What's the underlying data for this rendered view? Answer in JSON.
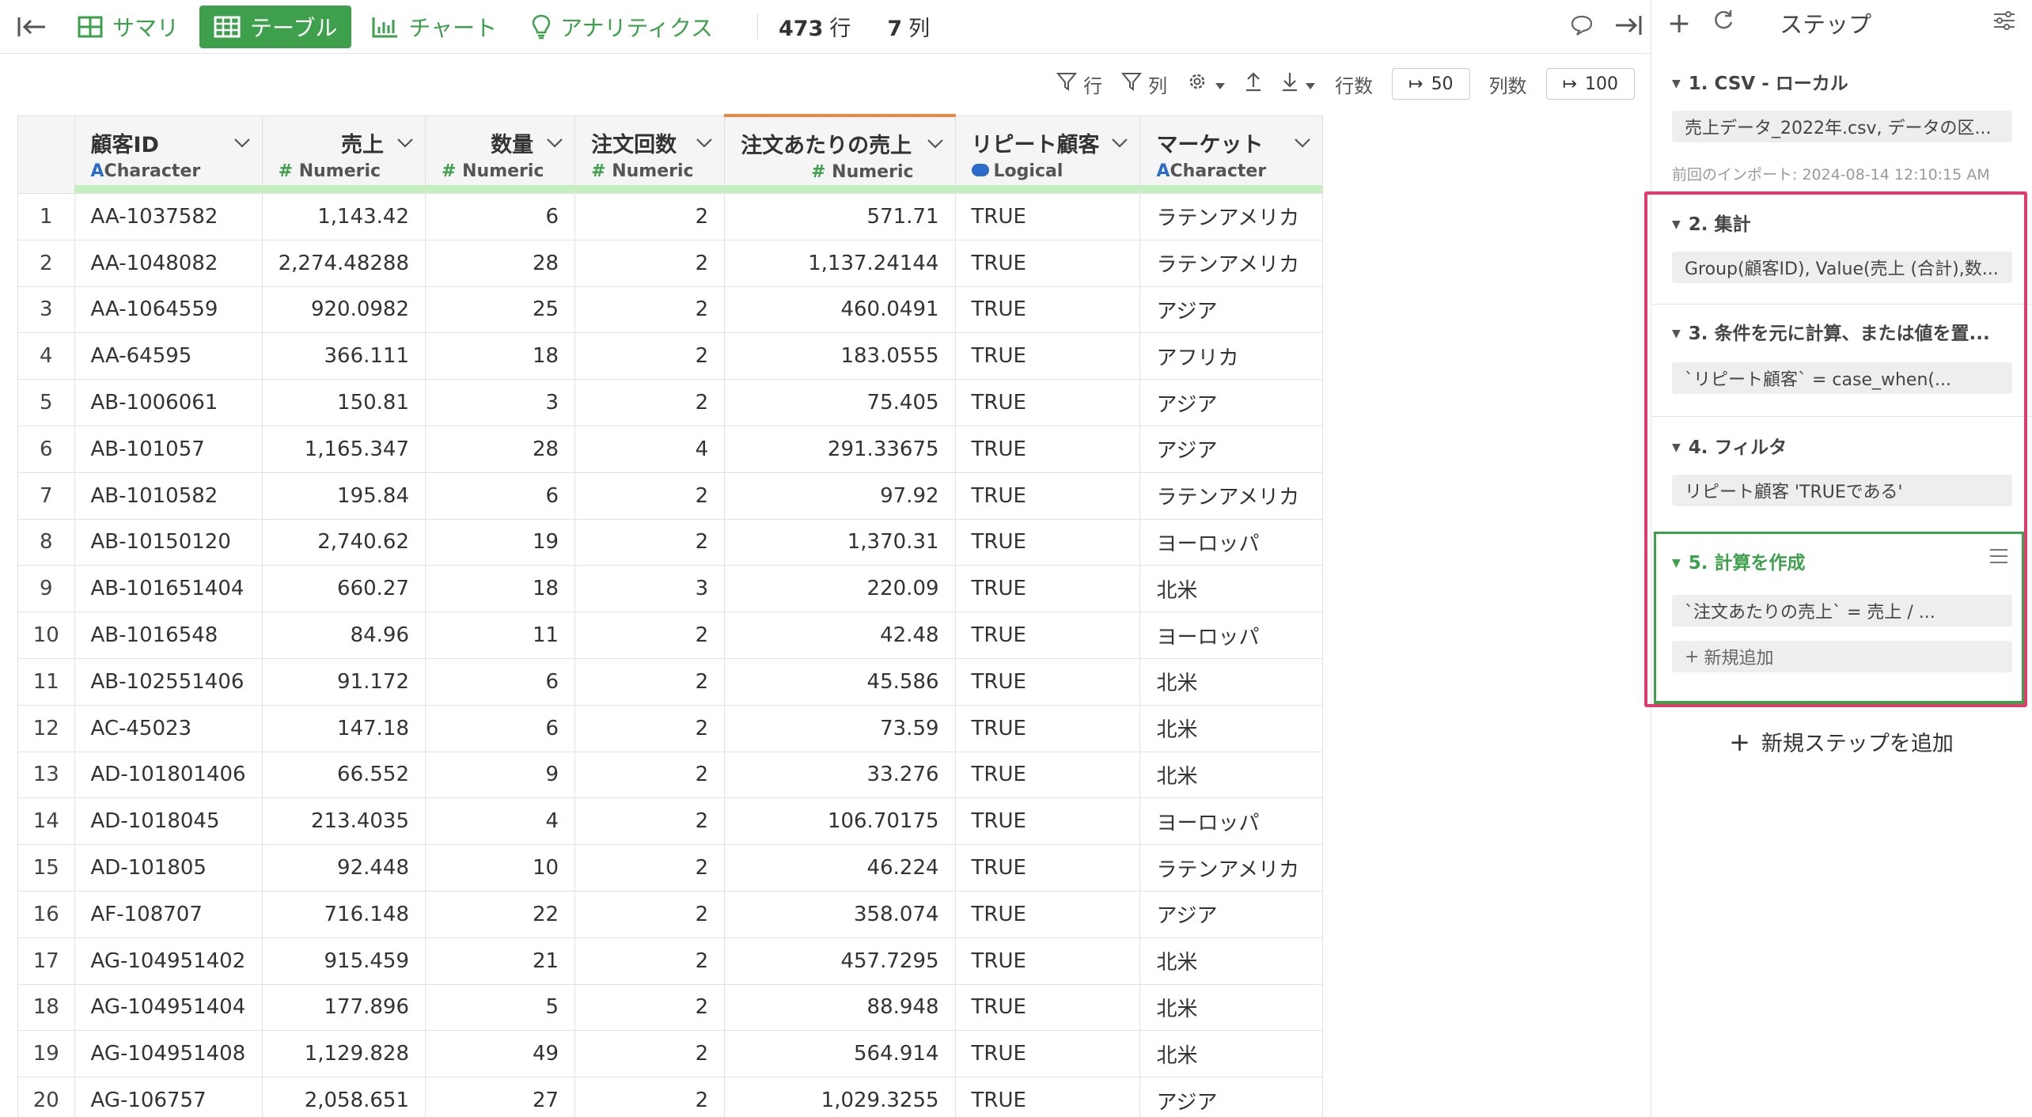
{
  "tabs": [
    {
      "label": "サマリ",
      "icon": "summary-icon",
      "active": false
    },
    {
      "label": "テーブル",
      "icon": "table-icon",
      "active": true
    },
    {
      "label": "チャート",
      "icon": "chart-icon",
      "active": false
    },
    {
      "label": "アナリティクス",
      "icon": "lightbulb-icon",
      "active": false
    }
  ],
  "counts": {
    "rows_value": "473",
    "rows_unit": "行",
    "cols_value": "7",
    "cols_unit": "列"
  },
  "subbar": {
    "filter_rows_label": "行",
    "filter_cols_label": "列",
    "row_count_label": "行数",
    "row_count_value": "50",
    "col_count_label": "列数",
    "col_count_value": "100"
  },
  "columns": [
    {
      "name": "顧客ID",
      "type": "Character",
      "type_marker": "A",
      "align": "left"
    },
    {
      "name": "売上",
      "type": "Numeric",
      "type_marker": "#",
      "align": "right"
    },
    {
      "name": "数量",
      "type": "Numeric",
      "type_marker": "#",
      "align": "right"
    },
    {
      "name": "注文回数",
      "type": "Numeric",
      "type_marker": "#",
      "align": "left"
    },
    {
      "name": "注文あたりの売上",
      "type": "Numeric",
      "type_marker": "#",
      "align": "right"
    },
    {
      "name": "リピート顧客",
      "type": "Logical",
      "type_marker": "",
      "align": "left"
    },
    {
      "name": "マーケット",
      "type": "Character",
      "type_marker": "A",
      "align": "left"
    }
  ],
  "rows": [
    [
      "1",
      "AA-1037582",
      "1,143.42",
      "6",
      "2",
      "571.71",
      "TRUE",
      "ラテンアメリカ"
    ],
    [
      "2",
      "AA-1048082",
      "2,274.48288",
      "28",
      "2",
      "1,137.24144",
      "TRUE",
      "ラテンアメリカ"
    ],
    [
      "3",
      "AA-1064559",
      "920.0982",
      "25",
      "2",
      "460.0491",
      "TRUE",
      "アジア"
    ],
    [
      "4",
      "AA-64595",
      "366.111",
      "18",
      "2",
      "183.0555",
      "TRUE",
      "アフリカ"
    ],
    [
      "5",
      "AB-1006061",
      "150.81",
      "3",
      "2",
      "75.405",
      "TRUE",
      "アジア"
    ],
    [
      "6",
      "AB-101057",
      "1,165.347",
      "28",
      "4",
      "291.33675",
      "TRUE",
      "アジア"
    ],
    [
      "7",
      "AB-1010582",
      "195.84",
      "6",
      "2",
      "97.92",
      "TRUE",
      "ラテンアメリカ"
    ],
    [
      "8",
      "AB-10150120",
      "2,740.62",
      "19",
      "2",
      "1,370.31",
      "TRUE",
      "ヨーロッパ"
    ],
    [
      "9",
      "AB-101651404",
      "660.27",
      "18",
      "3",
      "220.09",
      "TRUE",
      "北米"
    ],
    [
      "10",
      "AB-1016548",
      "84.96",
      "11",
      "2",
      "42.48",
      "TRUE",
      "ヨーロッパ"
    ],
    [
      "11",
      "AB-102551406",
      "91.172",
      "6",
      "2",
      "45.586",
      "TRUE",
      "北米"
    ],
    [
      "12",
      "AC-45023",
      "147.18",
      "6",
      "2",
      "73.59",
      "TRUE",
      "北米"
    ],
    [
      "13",
      "AD-101801406",
      "66.552",
      "9",
      "2",
      "33.276",
      "TRUE",
      "北米"
    ],
    [
      "14",
      "AD-1018045",
      "213.4035",
      "4",
      "2",
      "106.70175",
      "TRUE",
      "ヨーロッパ"
    ],
    [
      "15",
      "AD-101805",
      "92.448",
      "10",
      "2",
      "46.224",
      "TRUE",
      "ラテンアメリカ"
    ],
    [
      "16",
      "AF-108707",
      "716.148",
      "22",
      "2",
      "358.074",
      "TRUE",
      "アジア"
    ],
    [
      "17",
      "AG-104951402",
      "915.459",
      "21",
      "2",
      "457.7295",
      "TRUE",
      "北米"
    ],
    [
      "18",
      "AG-104951404",
      "177.896",
      "5",
      "2",
      "88.948",
      "TRUE",
      "北米"
    ],
    [
      "19",
      "AG-104951408",
      "1,129.828",
      "49",
      "2",
      "564.914",
      "TRUE",
      "北米"
    ],
    [
      "20",
      "AG-106757",
      "2,058.651",
      "27",
      "2",
      "1,029.3255",
      "TRUE",
      "アジア"
    ]
  ],
  "panel": {
    "title": "ステップ",
    "steps": [
      {
        "title": "1. CSV - ローカル",
        "detail": "売上データ_2022年.csv, データの区...",
        "note": "前回のインポート: 2024-08-14 12:10:15 AM"
      },
      {
        "title": "2. 集計",
        "detail": "Group(顧客ID), Value(売上 (合計),数..."
      },
      {
        "title": "3. 条件を元に計算、または値を置...",
        "detail": "`リピート顧客` = case_when(..."
      },
      {
        "title": "4. フィルタ",
        "detail": "リピート顧客 'TRUEである'"
      },
      {
        "title": "5. 計算を作成",
        "detail": "`注文あたりの売上` = 売上 / ...",
        "add_label": "新規追加"
      }
    ],
    "add_step_label": "新規ステップを追加"
  },
  "colors": {
    "accent_green": "#3ea04c",
    "highlight_pink": "#e23a6b",
    "type_blue": "#2b6cc8",
    "selected_col_orange": "#e8894a"
  }
}
